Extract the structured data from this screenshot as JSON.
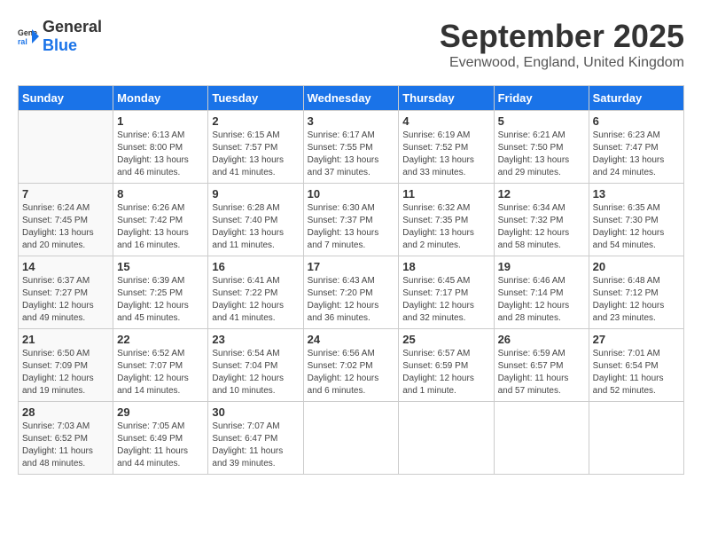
{
  "header": {
    "logo_general": "General",
    "logo_blue": "Blue",
    "month": "September 2025",
    "location": "Evenwood, England, United Kingdom"
  },
  "days_of_week": [
    "Sunday",
    "Monday",
    "Tuesday",
    "Wednesday",
    "Thursday",
    "Friday",
    "Saturday"
  ],
  "weeks": [
    {
      "days": [
        {
          "num": "",
          "content": ""
        },
        {
          "num": "1",
          "content": "Sunrise: 6:13 AM\nSunset: 8:00 PM\nDaylight: 13 hours\nand 46 minutes."
        },
        {
          "num": "2",
          "content": "Sunrise: 6:15 AM\nSunset: 7:57 PM\nDaylight: 13 hours\nand 41 minutes."
        },
        {
          "num": "3",
          "content": "Sunrise: 6:17 AM\nSunset: 7:55 PM\nDaylight: 13 hours\nand 37 minutes."
        },
        {
          "num": "4",
          "content": "Sunrise: 6:19 AM\nSunset: 7:52 PM\nDaylight: 13 hours\nand 33 minutes."
        },
        {
          "num": "5",
          "content": "Sunrise: 6:21 AM\nSunset: 7:50 PM\nDaylight: 13 hours\nand 29 minutes."
        },
        {
          "num": "6",
          "content": "Sunrise: 6:23 AM\nSunset: 7:47 PM\nDaylight: 13 hours\nand 24 minutes."
        }
      ]
    },
    {
      "days": [
        {
          "num": "7",
          "content": "Sunrise: 6:24 AM\nSunset: 7:45 PM\nDaylight: 13 hours\nand 20 minutes."
        },
        {
          "num": "8",
          "content": "Sunrise: 6:26 AM\nSunset: 7:42 PM\nDaylight: 13 hours\nand 16 minutes."
        },
        {
          "num": "9",
          "content": "Sunrise: 6:28 AM\nSunset: 7:40 PM\nDaylight: 13 hours\nand 11 minutes."
        },
        {
          "num": "10",
          "content": "Sunrise: 6:30 AM\nSunset: 7:37 PM\nDaylight: 13 hours\nand 7 minutes."
        },
        {
          "num": "11",
          "content": "Sunrise: 6:32 AM\nSunset: 7:35 PM\nDaylight: 13 hours\nand 2 minutes."
        },
        {
          "num": "12",
          "content": "Sunrise: 6:34 AM\nSunset: 7:32 PM\nDaylight: 12 hours\nand 58 minutes."
        },
        {
          "num": "13",
          "content": "Sunrise: 6:35 AM\nSunset: 7:30 PM\nDaylight: 12 hours\nand 54 minutes."
        }
      ]
    },
    {
      "days": [
        {
          "num": "14",
          "content": "Sunrise: 6:37 AM\nSunset: 7:27 PM\nDaylight: 12 hours\nand 49 minutes."
        },
        {
          "num": "15",
          "content": "Sunrise: 6:39 AM\nSunset: 7:25 PM\nDaylight: 12 hours\nand 45 minutes."
        },
        {
          "num": "16",
          "content": "Sunrise: 6:41 AM\nSunset: 7:22 PM\nDaylight: 12 hours\nand 41 minutes."
        },
        {
          "num": "17",
          "content": "Sunrise: 6:43 AM\nSunset: 7:20 PM\nDaylight: 12 hours\nand 36 minutes."
        },
        {
          "num": "18",
          "content": "Sunrise: 6:45 AM\nSunset: 7:17 PM\nDaylight: 12 hours\nand 32 minutes."
        },
        {
          "num": "19",
          "content": "Sunrise: 6:46 AM\nSunset: 7:14 PM\nDaylight: 12 hours\nand 28 minutes."
        },
        {
          "num": "20",
          "content": "Sunrise: 6:48 AM\nSunset: 7:12 PM\nDaylight: 12 hours\nand 23 minutes."
        }
      ]
    },
    {
      "days": [
        {
          "num": "21",
          "content": "Sunrise: 6:50 AM\nSunset: 7:09 PM\nDaylight: 12 hours\nand 19 minutes."
        },
        {
          "num": "22",
          "content": "Sunrise: 6:52 AM\nSunset: 7:07 PM\nDaylight: 12 hours\nand 14 minutes."
        },
        {
          "num": "23",
          "content": "Sunrise: 6:54 AM\nSunset: 7:04 PM\nDaylight: 12 hours\nand 10 minutes."
        },
        {
          "num": "24",
          "content": "Sunrise: 6:56 AM\nSunset: 7:02 PM\nDaylight: 12 hours\nand 6 minutes."
        },
        {
          "num": "25",
          "content": "Sunrise: 6:57 AM\nSunset: 6:59 PM\nDaylight: 12 hours\nand 1 minute."
        },
        {
          "num": "26",
          "content": "Sunrise: 6:59 AM\nSunset: 6:57 PM\nDaylight: 11 hours\nand 57 minutes."
        },
        {
          "num": "27",
          "content": "Sunrise: 7:01 AM\nSunset: 6:54 PM\nDaylight: 11 hours\nand 52 minutes."
        }
      ]
    },
    {
      "days": [
        {
          "num": "28",
          "content": "Sunrise: 7:03 AM\nSunset: 6:52 PM\nDaylight: 11 hours\nand 48 minutes."
        },
        {
          "num": "29",
          "content": "Sunrise: 7:05 AM\nSunset: 6:49 PM\nDaylight: 11 hours\nand 44 minutes."
        },
        {
          "num": "30",
          "content": "Sunrise: 7:07 AM\nSunset: 6:47 PM\nDaylight: 11 hours\nand 39 minutes."
        },
        {
          "num": "",
          "content": ""
        },
        {
          "num": "",
          "content": ""
        },
        {
          "num": "",
          "content": ""
        },
        {
          "num": "",
          "content": ""
        }
      ]
    }
  ]
}
